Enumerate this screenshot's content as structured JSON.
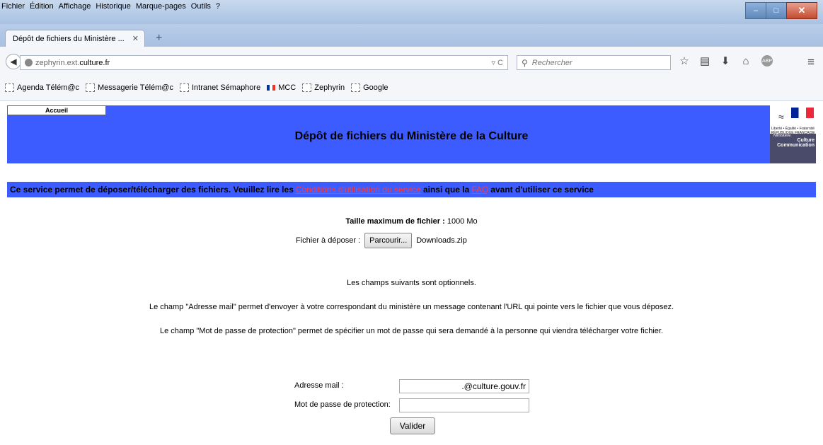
{
  "menubar": {
    "items": [
      "Fichier",
      "Édition",
      "Affichage",
      "Historique",
      "Marque-pages",
      "Outils",
      "?"
    ]
  },
  "tabs": [
    {
      "label": "Dépôt de fichiers du Ministère ..."
    }
  ],
  "address": {
    "prefix": "zephyrin.ext.",
    "domain": "culture.fr"
  },
  "search": {
    "placeholder": "Rechercher"
  },
  "bookmarks": [
    {
      "label": "Agenda Télém@c",
      "icon": "page-icon"
    },
    {
      "label": "Messagerie Télém@c",
      "icon": "page-icon"
    },
    {
      "label": "Intranet Sémaphore",
      "icon": "page-icon"
    },
    {
      "label": "MCC",
      "icon": "flag-icon"
    },
    {
      "label": "Zephyrin",
      "icon": "page-icon"
    },
    {
      "label": "Google",
      "icon": "page-icon"
    }
  ],
  "page": {
    "home_label": "Accueil",
    "title": "Dépôt de fichiers du Ministère de la Culture",
    "logo_text": {
      "rf": "Liberté • Égalité • Fraternité RÉPUBLIQUE FRANÇAISE",
      "ministere": "Ministère",
      "culture": "Culture",
      "communication": "Communication"
    },
    "notice": {
      "before": "Ce service permet de déposer/télécharger des fichiers. Veuillez lire les",
      "link1": "Conditions d'utilisation du service",
      "middle": "ainsi que la",
      "link2": "FAQ",
      "after": "avant d'utiliser ce service"
    },
    "max_size_label": "Taille maximum de fichier :",
    "max_size_value": "1000 Mo",
    "file_label": "Fichier à déposer :",
    "browse_label": "Parcourir...",
    "file_name": "Downloads.zip",
    "optional_text": "Les champs suivants sont optionnels.",
    "email_help": "Le champ \"Adresse mail\" permet d'envoyer à votre correspondant du ministère un message contenant l'URL qui pointe vers le fichier que vous déposez.",
    "password_help": "Le champ \"Mot de passe de protection\" permet de spécifier un mot de passe qui sera demandé à la personne qui viendra télécharger votre fichier.",
    "email_label": "Adresse mail :",
    "email_value": ".@culture.gouv.fr",
    "password_label": "Mot de passe de protection:",
    "password_value": "",
    "submit_label": "Valider"
  },
  "colors": {
    "banner": "#3d5cff",
    "link": "#ff3b3b"
  }
}
